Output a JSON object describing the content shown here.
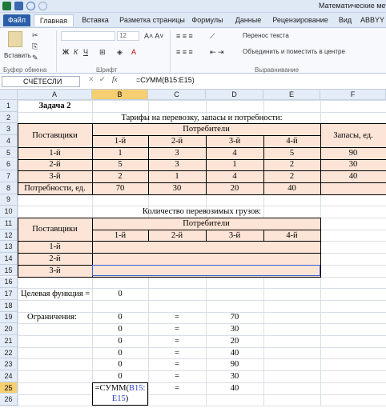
{
  "window_title": "Математические мето",
  "tabs": [
    "Файл",
    "Главная",
    "Вставка",
    "Разметка страницы",
    "Формулы",
    "Данные",
    "Рецензирование",
    "Вид",
    "ABBYY"
  ],
  "ribbon": {
    "paste_label": "Вставить",
    "font_size": "12",
    "bold": "Ж",
    "italic": "К",
    "underline": "Ч",
    "wrap_text": "Перенос текста",
    "merge_center": "Объединить и поместить в центре",
    "group_clipboard": "Буфер обмена",
    "group_font": "Шрифт",
    "group_alignment": "Выравнивание"
  },
  "formula_bar": {
    "name_box": "СЧЁТЕСЛИ",
    "fx": "fx",
    "formula": "=СУММ(B15:E15)"
  },
  "columns": [
    "A",
    "B",
    "C",
    "D",
    "E",
    "F"
  ],
  "rows": [
    "1",
    "2",
    "3",
    "4",
    "5",
    "6",
    "7",
    "8",
    "9",
    "10",
    "11",
    "12",
    "13",
    "14",
    "15",
    "16",
    "17",
    "18",
    "19",
    "20",
    "21",
    "22",
    "23",
    "24",
    "25",
    "26"
  ],
  "sheet": {
    "task_title": "Задача 2",
    "table1_title": "Тарифы на перевозку, запасы и потребности:",
    "suppliers": "Поставщики",
    "consumers": "Потребители",
    "stock": "Запасы, ед.",
    "consumer_cols": [
      "1-й",
      "2-й",
      "3-й",
      "4-й"
    ],
    "supplier_rows": [
      "1-й",
      "2-й",
      "3-й"
    ],
    "tariffs": [
      [
        "1",
        "3",
        "4",
        "5"
      ],
      [
        "5",
        "3",
        "1",
        "2"
      ],
      [
        "2",
        "1",
        "4",
        "2"
      ]
    ],
    "stocks": [
      "90",
      "30",
      "40"
    ],
    "needs_label": "Потребности, ед.",
    "needs": [
      "70",
      "30",
      "20",
      "40"
    ],
    "table2_title": "Количество перевозимых грузов:",
    "objective_label": "Целевая функция =",
    "objective_value": "0",
    "constraints_label": "Ограничения:",
    "constraints": [
      {
        "b": "0",
        "c": "=",
        "d": "70"
      },
      {
        "b": "0",
        "c": "=",
        "d": "30"
      },
      {
        "b": "0",
        "c": "=",
        "d": "20"
      },
      {
        "b": "0",
        "c": "=",
        "d": "40"
      },
      {
        "b": "0",
        "c": "=",
        "d": "90"
      },
      {
        "b": "0",
        "c": "=",
        "d": "30"
      },
      {
        "b": "",
        "c": "=",
        "d": "40"
      }
    ],
    "edit_prefix": "=СУММ(",
    "edit_ref1": "B15:",
    "edit_ref2": "E15",
    "edit_suffix": ")"
  }
}
